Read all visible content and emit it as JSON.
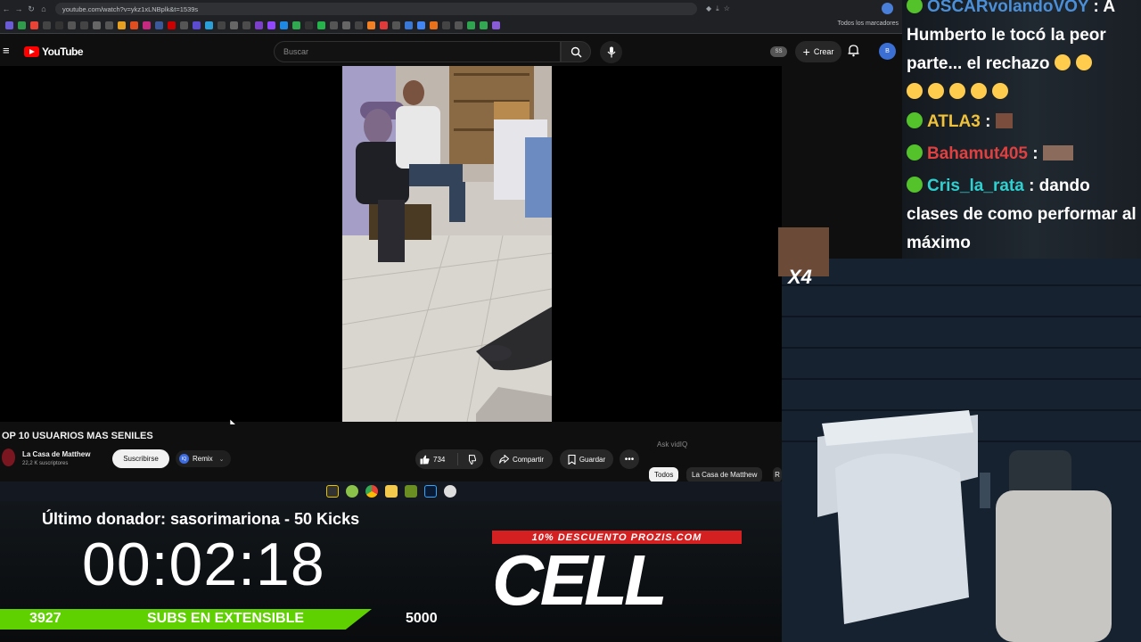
{
  "browser": {
    "url": "youtube.com/watch?v=ykz1xLNBplk&t=1539s",
    "bookmarks_all_label": "Todos los marcadores"
  },
  "youtube": {
    "logo_text": "YouTube",
    "search_placeholder": "Buscar",
    "badge_text": "SS",
    "create_label": "Crear",
    "avatar_text": "B"
  },
  "video": {
    "title": "OP 10 USUARIOS MAS SENILES",
    "channel_name": "La Casa de Matthew",
    "channel_subs": "22,2 K suscriptores",
    "subscribe_label": "Suscribirse",
    "remix_label": "Remix",
    "remix_badge": "IQ",
    "likes": "734",
    "share_label": "Compartir",
    "save_label": "Guardar",
    "ask_placeholder": "Ask vidIQ",
    "chips": [
      "Todos",
      "La Casa de Matthew",
      "R"
    ]
  },
  "chat": [
    {
      "user": "OSCARvolandoVOY",
      "user_color": "#4a8fd8",
      "text": " : A Humberto le tocó la peor parte... el rechazo"
    },
    {
      "user": "ATLA3",
      "user_color": "#f0c23a",
      "text": " :"
    },
    {
      "user": "Bahamut405",
      "user_color": "#e04040",
      "text": " :"
    },
    {
      "user": "Cris_la_rata",
      "user_color": "#2fd0d0",
      "text": " : dando clases de como performar al máximo"
    }
  ],
  "overlay": {
    "donor_text": "Último donador: sasorimariona - 50 Kicks",
    "timer": "00:02:18",
    "subs_current": "3927",
    "subs_label": "SUBS EN EXTENSIBLE",
    "subs_goal": "5000",
    "promo_text": "10% DESCUENTO PROZIS.COM",
    "sponsor_text": "CELL",
    "emote_multiplier": "X4"
  },
  "colors": {
    "youtube_red": "#ff0000",
    "subs_bar": "#5fd100",
    "promo_red": "#d42020",
    "chat_badge": "#53c22b"
  }
}
